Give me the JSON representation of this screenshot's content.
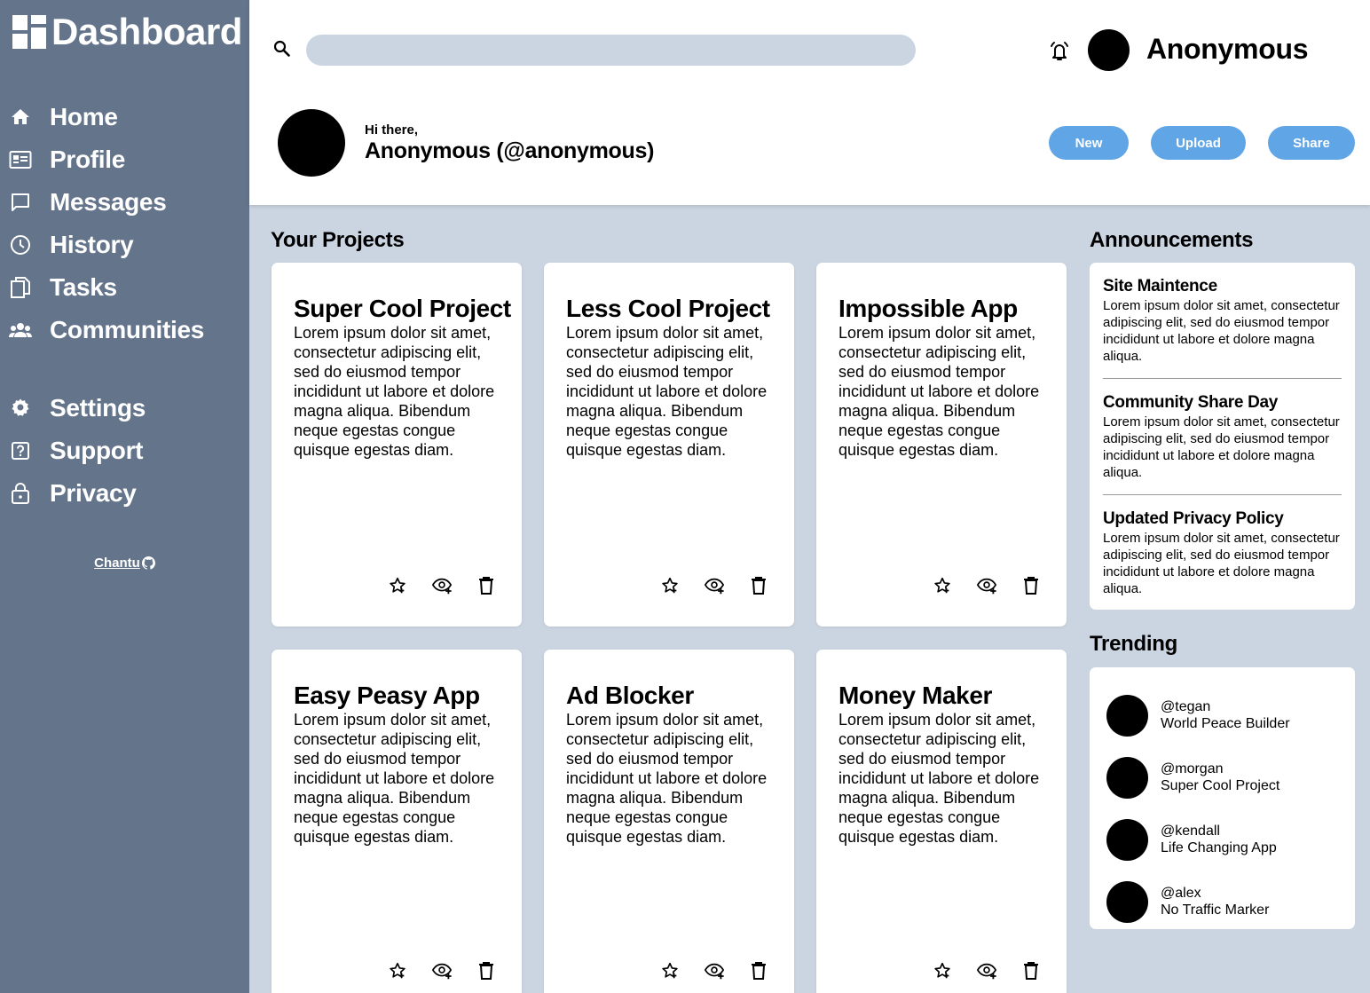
{
  "sidebar": {
    "brand": "Dashboard",
    "items": [
      {
        "label": "Home",
        "icon": "home-icon"
      },
      {
        "label": "Profile",
        "icon": "id-card-icon"
      },
      {
        "label": "Messages",
        "icon": "message-icon"
      },
      {
        "label": "History",
        "icon": "clock-icon"
      },
      {
        "label": "Tasks",
        "icon": "copy-icon"
      },
      {
        "label": "Communities",
        "icon": "people-icon"
      }
    ],
    "secondary_items": [
      {
        "label": "Settings",
        "icon": "gear-icon"
      },
      {
        "label": "Support",
        "icon": "help-icon"
      },
      {
        "label": "Privacy",
        "icon": "lock-icon"
      }
    ],
    "credit": "Chantu"
  },
  "header": {
    "search": {
      "placeholder": "",
      "value": ""
    },
    "username": "Anonymous",
    "greeting": "Hi there,",
    "profile_name": "Anonymous (@anonymous)",
    "buttons": {
      "new": "New",
      "upload": "Upload",
      "share": "Share"
    }
  },
  "projects": {
    "title": "Your Projects",
    "items": [
      {
        "title": "Super Cool Project",
        "description": "Lorem ipsum dolor sit amet, consectetur adipiscing elit, sed do eiusmod tempor incididunt ut labore et dolore magna aliqua. Bibendum neque egestas congue quisque egestas diam."
      },
      {
        "title": "Less Cool Project",
        "description": "Lorem ipsum dolor sit amet, consectetur adipiscing elit, sed do eiusmod tempor incididunt ut labore et dolore magna aliqua. Bibendum neque egestas congue quisque egestas diam."
      },
      {
        "title": "Impossible App",
        "description": "Lorem ipsum dolor sit amet, consectetur adipiscing elit, sed do eiusmod tempor incididunt ut labore et dolore magna aliqua. Bibendum neque egestas congue quisque egestas diam."
      },
      {
        "title": "Easy Peasy App",
        "description": "Lorem ipsum dolor sit amet, consectetur adipiscing elit, sed do eiusmod tempor incididunt ut labore et dolore magna aliqua. Bibendum neque egestas congue quisque egestas diam."
      },
      {
        "title": "Ad Blocker",
        "description": "Lorem ipsum dolor sit amet, consectetur adipiscing elit, sed do eiusmod tempor incididunt ut labore et dolore magna aliqua. Bibendum neque egestas congue quisque egestas diam."
      },
      {
        "title": "Money Maker",
        "description": "Lorem ipsum dolor sit amet, consectetur adipiscing elit, sed do eiusmod tempor incididunt ut labore et dolore magna aliqua. Bibendum neque egestas congue quisque egestas diam."
      }
    ]
  },
  "announcements": {
    "title": "Announcements",
    "items": [
      {
        "title": "Site Maintence",
        "body": "Lorem ipsum dolor sit amet, consectetur adipiscing elit, sed do eiusmod tempor incididunt ut labore et dolore magna aliqua."
      },
      {
        "title": "Community Share Day",
        "body": "Lorem ipsum dolor sit amet, consectetur adipiscing elit, sed do eiusmod tempor incididunt ut labore et dolore magna aliqua."
      },
      {
        "title": "Updated Privacy Policy",
        "body": "Lorem ipsum dolor sit amet, consectetur adipiscing elit, sed do eiusmod tempor incididunt ut labore et dolore magna aliqua."
      }
    ]
  },
  "trending": {
    "title": "Trending",
    "items": [
      {
        "handle": "@tegan",
        "project": "World Peace Builder"
      },
      {
        "handle": "@morgan",
        "project": "Super Cool Project"
      },
      {
        "handle": "@kendall",
        "project": "Life Changing App"
      },
      {
        "handle": "@alex",
        "project": "No Traffic Marker"
      }
    ]
  },
  "colors": {
    "sidebar_bg": "#64748b",
    "page_bg": "#cbd5e1",
    "button_bg": "#60a5e6"
  }
}
